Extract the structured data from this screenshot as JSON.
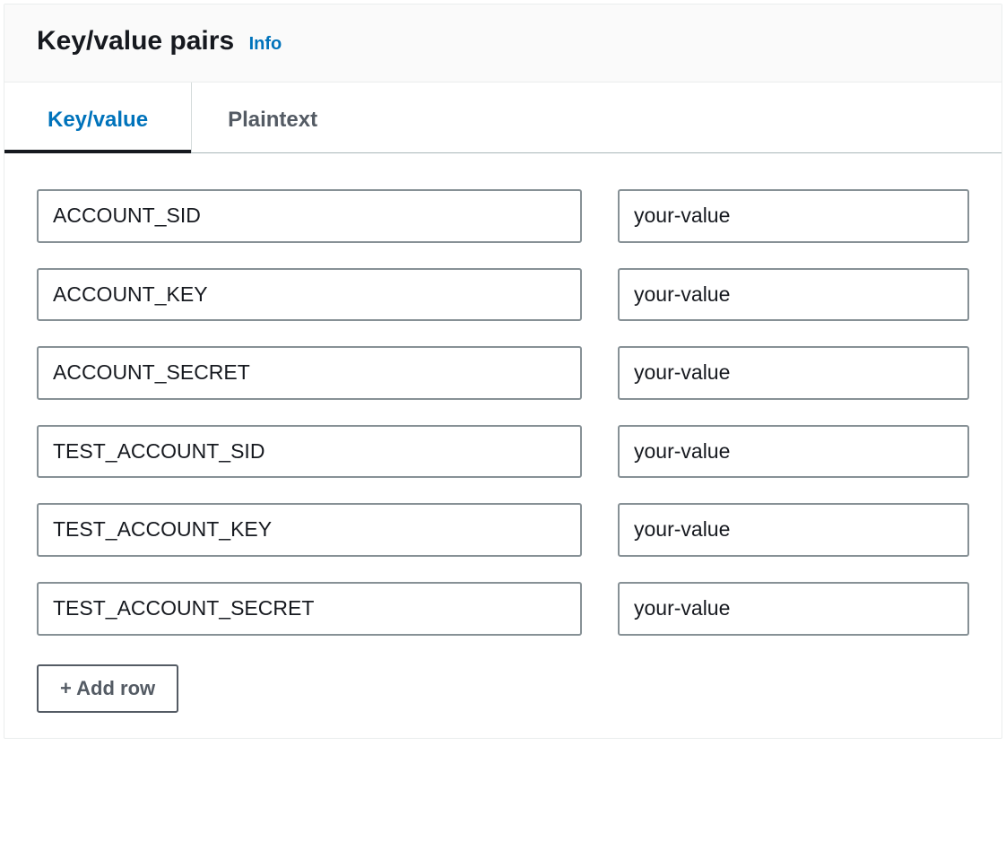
{
  "header": {
    "title": "Key/value pairs",
    "info_label": "Info"
  },
  "tabs": [
    {
      "label": "Key/value",
      "active": true
    },
    {
      "label": "Plaintext",
      "active": false
    }
  ],
  "rows": [
    {
      "key": "ACCOUNT_SID",
      "value": "your-value"
    },
    {
      "key": "ACCOUNT_KEY",
      "value": "your-value"
    },
    {
      "key": "ACCOUNT_SECRET",
      "value": "your-value"
    },
    {
      "key": "TEST_ACCOUNT_SID",
      "value": "your-value"
    },
    {
      "key": "TEST_ACCOUNT_KEY",
      "value": "your-value"
    },
    {
      "key": "TEST_ACCOUNT_SECRET",
      "value": "your-value"
    }
  ],
  "add_row_label": "+ Add row"
}
